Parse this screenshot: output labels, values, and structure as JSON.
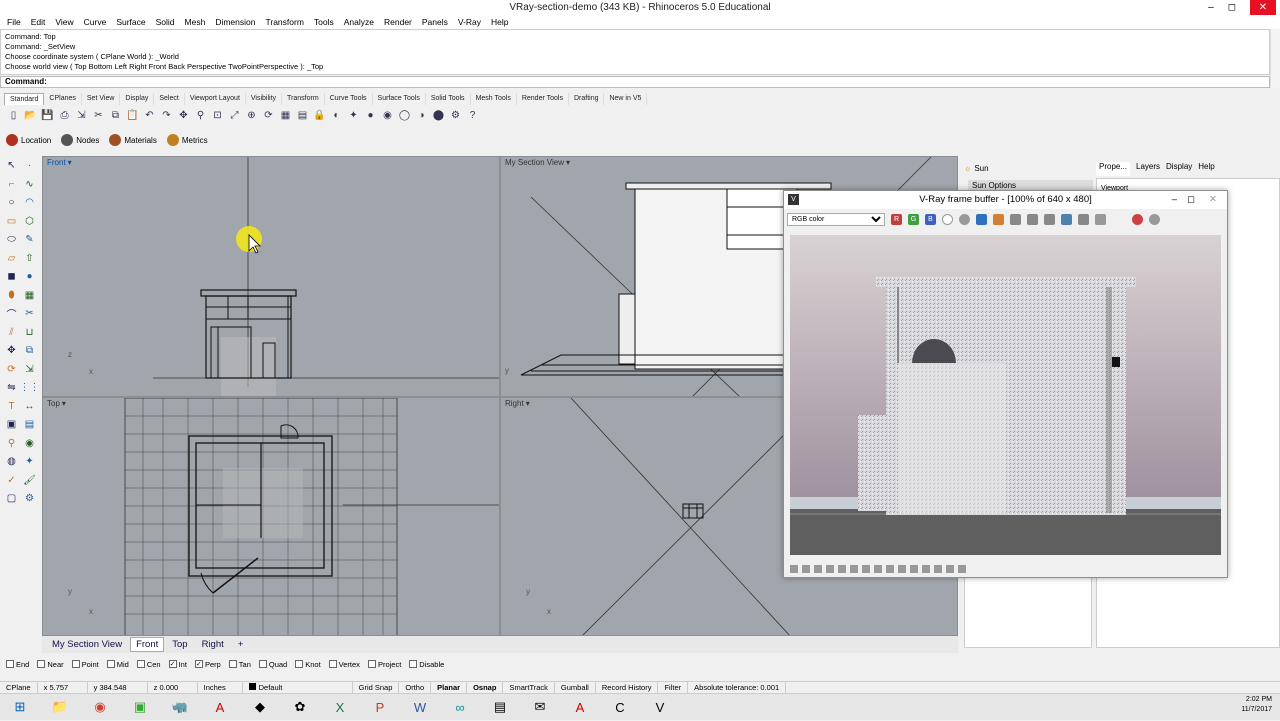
{
  "window": {
    "title": "VRay-section-demo (343 KB) - Rhinoceros 5.0 Educational",
    "min": "–",
    "max": "◻",
    "close": "✕"
  },
  "menu": [
    "File",
    "Edit",
    "View",
    "Curve",
    "Surface",
    "Solid",
    "Mesh",
    "Dimension",
    "Transform",
    "Tools",
    "Analyze",
    "Render",
    "Panels",
    "V-Ray",
    "Help"
  ],
  "command_history": [
    "Command: Top",
    "Command: _SetView",
    "Choose coordinate system ( CPlane  World ): _World",
    "Choose world view ( Top  Bottom  Left  Right  Front  Back  Perspective  TwoPointPerspective ): _Top"
  ],
  "command_prompt": "Command:",
  "toolbar_tabs": [
    "Standard",
    "CPlanes",
    "Set View",
    "Display",
    "Select",
    "Viewport Layout",
    "Visibility",
    "Transform",
    "Curve Tools",
    "Surface Tools",
    "Solid Tools",
    "Mesh Tools",
    "Render Tools",
    "Drafting",
    "New in V5"
  ],
  "toolbar_active_tab": "Standard",
  "toolbar_icons": [
    "new-icon",
    "open-icon",
    "save-icon",
    "print-icon",
    "import-icon",
    "cut-icon",
    "copy-icon",
    "paste-icon",
    "undo-icon",
    "redo-icon",
    "pan-icon",
    "zoom-icon",
    "zoom-window-icon",
    "zoom-extents-icon",
    "zoom-selected-icon",
    "rotate-view-icon",
    "grid-icon",
    "layer-icon",
    "lock-icon",
    "hide-icon",
    "light-icon",
    "render-icon",
    "material-icon",
    "sphere-icon",
    "shaded-icon",
    "rendered-icon",
    "settings-icon",
    "help-icon"
  ],
  "vray_bar": [
    {
      "label": "Location",
      "icon": "globe-icon",
      "color": "#b03020"
    },
    {
      "label": "Nodes",
      "icon": "nodes-icon",
      "color": "#555555"
    },
    {
      "label": "Materials",
      "icon": "materials-icon",
      "color": "#a05020"
    },
    {
      "label": "Metrics",
      "icon": "metrics-icon",
      "color": "#c08020"
    }
  ],
  "viewports": {
    "front": {
      "label": "Front",
      "axis_y": "z",
      "axis_x": "x"
    },
    "section": {
      "label": "My Section View",
      "axis_y": "y"
    },
    "top": {
      "label": "Top",
      "axis_y": "y",
      "axis_x": "x"
    },
    "right": {
      "label": "Right",
      "axis_y": "y",
      "axis_x": "x"
    }
  },
  "viewport_tabs": [
    "My Section View",
    "Front",
    "Top",
    "Right"
  ],
  "viewport_active_tab": "Front",
  "osnap": [
    {
      "label": "End",
      "checked": false
    },
    {
      "label": "Near",
      "checked": false
    },
    {
      "label": "Point",
      "checked": false
    },
    {
      "label": "Mid",
      "checked": false
    },
    {
      "label": "Cen",
      "checked": false
    },
    {
      "label": "Int",
      "checked": true
    },
    {
      "label": "Perp",
      "checked": true
    },
    {
      "label": "Tan",
      "checked": false
    },
    {
      "label": "Quad",
      "checked": false
    },
    {
      "label": "Knot",
      "checked": false
    },
    {
      "label": "Vertex",
      "checked": false
    },
    {
      "label": "Project",
      "checked": false
    },
    {
      "label": "Disable",
      "checked": false
    }
  ],
  "status": {
    "cplane": "CPlane",
    "x": "x 5.757",
    "y": "y 384.548",
    "z": "z 0.000",
    "units": "Inches",
    "layer": "Default",
    "grid_snap": "Grid Snap",
    "ortho": "Ortho",
    "planar": "Planar",
    "osnap": "Osnap",
    "smarttrack": "SmartTrack",
    "gumball": "Gumball",
    "record_history": "Record History",
    "filter": "Filter",
    "tolerance": "Absolute tolerance: 0.001"
  },
  "right_panel": {
    "sun_tab": "Sun",
    "sun_options": "Sun Options",
    "tabs": [
      "Prope...",
      "Layers",
      "Display",
      "Help"
    ],
    "viewport_label": "Viewport"
  },
  "vfb": {
    "title": "V-Ray frame buffer - [100% of 640 x 480]",
    "channel": "RGB color",
    "channel_options": [
      "RGB color"
    ],
    "buttons": [
      "R",
      "G",
      "B"
    ]
  },
  "tray": {
    "time": "2:02 PM",
    "date": "11/7/2017"
  },
  "taskbar": [
    "windows-icon",
    "file-explorer-icon",
    "chrome-icon",
    "app-green-icon",
    "rhino-icon",
    "acrobat-icon",
    "app-teal-icon",
    "app-pink-icon",
    "excel-icon",
    "powerpoint-icon",
    "word-icon",
    "arduino-icon",
    "app-blue-icon",
    "outlook-icon",
    "acrobat-dc-icon",
    "app-c-icon",
    "vray-icon"
  ]
}
